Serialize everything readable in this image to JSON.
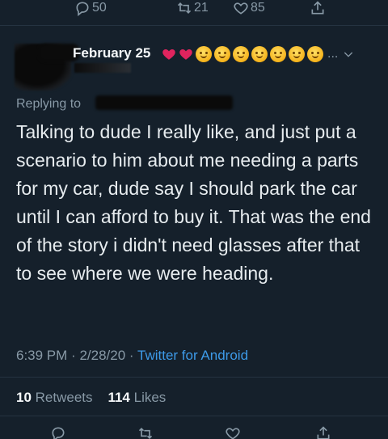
{
  "top_actions": {
    "reply_count": "50",
    "retweet_count": "21",
    "like_count": "85"
  },
  "header": {
    "date": "February 25",
    "emojis": [
      "red-heart",
      "red-heart",
      "face-blowing-kiss",
      "face-blowing-kiss",
      "face-blowing-kiss",
      "hugging-face",
      "hugging-face",
      "hugging-face",
      "smiling-face"
    ],
    "ellipsis": "..."
  },
  "reply": {
    "label": "Replying to"
  },
  "tweet": {
    "text": "Talking to dude I really like, and just put a scenario to him about me needing a parts for my car, dude say I should park the car until I can afford to buy it. That was the end of the story i didn't need glasses after that to see where we were heading."
  },
  "meta": {
    "time": "6:39 PM",
    "date": "2/28/20",
    "separator": "·",
    "client": "Twitter for Android"
  },
  "stats": {
    "retweets_count": "10",
    "retweets_label": "Retweets",
    "likes_count": "114",
    "likes_label": "Likes"
  },
  "colors": {
    "background": "#15202b",
    "muted": "#8899a6",
    "link": "#3d9ae8",
    "heart": "#e0245e"
  }
}
